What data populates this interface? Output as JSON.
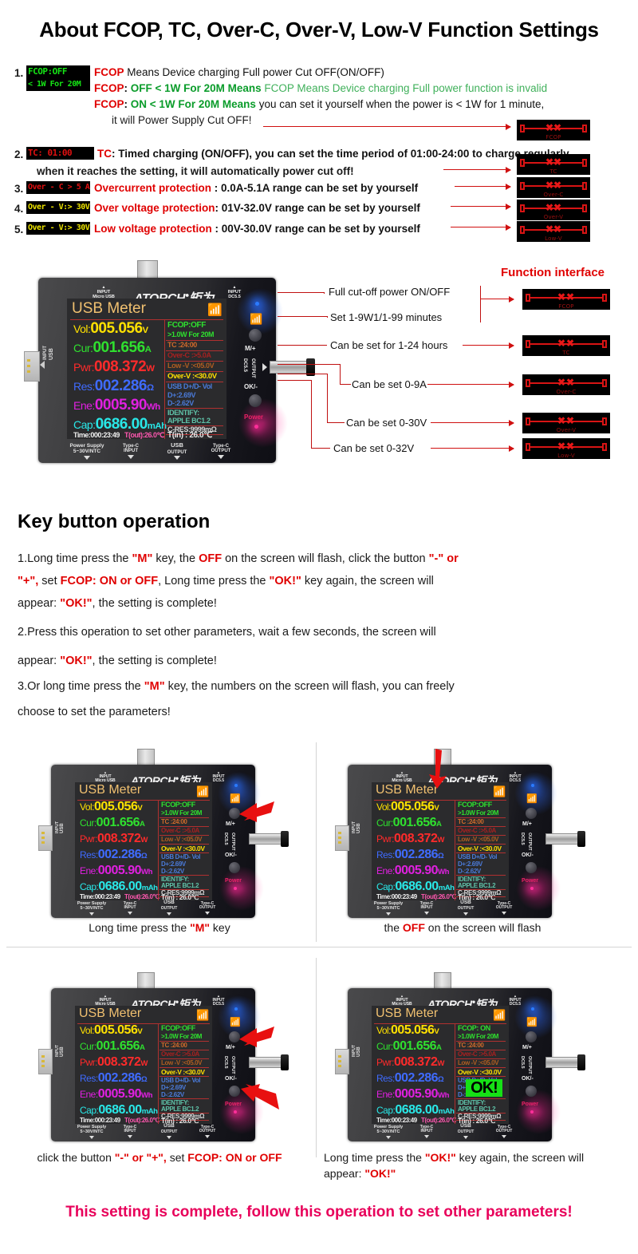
{
  "title": "About FCOP, TC, Over-C, Over-V, Low-V Function Settings",
  "list": {
    "items": [
      {
        "num": "1.",
        "badge_line1": "FCOP:OFF",
        "badge_line2": "< 1W For 20M",
        "line1_a": "FCOP",
        "line1_b": " Means Device charging Full power Cut OFF(ON/OFF)",
        "line2_a": "FCOP",
        "line2_b": ": ",
        "line2_c": "OFF < 1W For 20M Means",
        "line2_d": " FCOP Means Device charging Full power function is invalid",
        "line3_a": "FCOP",
        "line3_b": ": ",
        "line3_c": "ON  < 1W For 20M Means",
        "line3_d": " you can set it yourself when the power is < 1W for 1 minute,",
        "line4": "it will Power Supply Cut OFF!"
      },
      {
        "num": "2.",
        "badge": "TC:        01:00",
        "line1_a": "TC",
        "line1_b": ": Timed charging (ON/OFF), you can set the time period of 01:00-24:00 to charge regularly",
        "line2": "when it reaches the setting, it will automatically power cut off!"
      },
      {
        "num": "3.",
        "badge": "Over - C > 5 A",
        "line_a": "Overcurrent protection",
        "line_b": " : 0.0A-5.1A range can be set by yourself"
      },
      {
        "num": "4.",
        "badge": "Over - V:> 30V",
        "line_a": "Over voltage protection",
        "line_b": ": 01V-32.0V range can be set by yourself"
      },
      {
        "num": "5.",
        "badge": "Over - V:> 30V",
        "line_a": "Low voltage protection",
        "line_b": " : 00V-30.0V range can be set by yourself"
      }
    ]
  },
  "function_interface": {
    "heading": "Function interface",
    "icons": [
      "FCOP",
      "TC",
      "Over-C",
      "Over-V",
      "Low-V"
    ]
  },
  "device": {
    "brand": "ATORCH",
    "brand_cn": "矩为",
    "input_micro_usb": "INPUT\nMicro USB",
    "input_micro_usb_l1": "INPUT",
    "input_micro_usb_l2": "Micro USB",
    "input_dc_l1": "INPUT",
    "input_dc_l2": "DC5.5",
    "screen_title": "USB Meter",
    "bluetooth_icon": "bluetooth-icon",
    "rows": [
      {
        "label": "Vol:",
        "value": "005.056",
        "unit": "V",
        "color": "#ffe100"
      },
      {
        "label": "Cur:",
        "value": "001.656",
        "unit": "A",
        "color": "#2fe02f"
      },
      {
        "label": "Pwr:",
        "value": "008.372",
        "unit": "W",
        "color": "#ff2b2b"
      },
      {
        "label": "Res:",
        "value": "002.286",
        "unit": "Ω",
        "color": "#3f6bff"
      },
      {
        "label": "Ene:",
        "value": "0005.90",
        "unit": "Wh",
        "color": "#e020e0"
      },
      {
        "label": "Cap:",
        "value": "0686.00",
        "unit": "mAh",
        "color": "#29e8e8"
      }
    ],
    "time_line": "Time:000:23:49",
    "tout_line": "T(out):26.0℃",
    "right_lines": [
      {
        "text": "FCOP:OFF",
        "color": "#2ee02e"
      },
      {
        "text": ">1.0W  For  20M",
        "color": "#2ee02e"
      },
      {
        "text": "TC  :24:00",
        "color": "#d06a2a"
      },
      {
        "text": "Over-C :>5.0A",
        "color": "#a82020"
      },
      {
        "text": "Low -V :<05.0V",
        "color": "#b05e20"
      },
      {
        "text": "Over-V :<30.0V",
        "color": "#ffe100"
      },
      {
        "text": "USB D+/D- Vol",
        "color": "#4a7ad8"
      },
      {
        "text": "D+:2.69V",
        "color": "#4a7ad8"
      },
      {
        "text": "D-:2.62V",
        "color": "#4a7ad8"
      },
      {
        "text": "IDENTIFY:",
        "color": "#5fc2a8"
      },
      {
        "text": "APPLE      BC1.2",
        "color": "#5fc2a8"
      },
      {
        "text": "C-RES:9999mΩ",
        "color": "#d8d8d8"
      },
      {
        "text": "T(in)  :  26.0℃",
        "color": "#e8e8e8"
      }
    ],
    "right_lines_on": [
      {
        "text": "FCOP: ON",
        "color": "#2ee02e"
      },
      {
        "text": ">1.0W  For  20M",
        "color": "#2ee02e"
      }
    ],
    "fcop_on_text": "FCOP: ON",
    "side_buttons": {
      "m_plus": "M/+",
      "ok_minus": "OK/-",
      "power": "Power",
      "dc_out_l1": "DC5.5",
      "dc_out_l2": "OUTPUT"
    },
    "left_label_l1": "INPUT",
    "left_label_l2": "USB",
    "ports": [
      {
        "l1": "Power Supply",
        "l2": "5~30V/NTC"
      },
      {
        "l1": "Type-C",
        "l2": "INPUT"
      },
      {
        "l1": "USB",
        "l2": "OUTPUT"
      },
      {
        "l1": "Type-C",
        "l2": "OUTPUT"
      }
    ],
    "ok_badge": "OK!"
  },
  "callouts": [
    "Full cut-off power ON/OFF",
    "Set 1-9W1/1-99 minutes",
    "Can be set for 1-24 hours",
    "Can be set 0-9A",
    "Can be set 0-30V",
    "Can be set 0-32V"
  ],
  "key_operation": {
    "heading": "Key button operation",
    "l1_a": "1.Long time press the ",
    "l1_b": "\"M\"",
    "l1_c": " key, the ",
    "l1_d": "OFF",
    "l1_e": " on the screen will flash, click the button ",
    "l1_f": "\"-\" or",
    "l2_a": "\"+\",",
    "l2_b": " set ",
    "l2_c": "FCOP: ON or OFF",
    "l2_d": ", Long time press the ",
    "l2_e": "\"OK!\"",
    "l2_f": " key again, the screen will",
    "l3_a": "appear: ",
    "l3_b": "\"OK!\"",
    "l3_c": ", the setting is complete!",
    "l4": "2.Press this operation to set other parameters, wait a few seconds, the screen will",
    "l5_a": "appear: ",
    "l5_b": "\"OK!\"",
    "l5_c": ", the setting is complete!",
    "l6_a": "3.Or long time press the ",
    "l6_b": "\"M\"",
    "l6_c": " key, the numbers on the screen will flash, you can freely",
    "l7": "choose to set the parameters!"
  },
  "panel_captions": {
    "p1_a": "Long time press the ",
    "p1_b": "\"M\"",
    "p1_c": " key",
    "p2_a": "the ",
    "p2_b": "OFF",
    "p2_c": " on the screen will flash",
    "p3_a": "click the button ",
    "p3_b": "\"-\" or \"+\",",
    "p3_c": " set ",
    "p3_d": "FCOP: ON or OFF",
    "p4_a": "Long time press the ",
    "p4_b": "\"OK!\"",
    "p4_c": " key again, the screen will",
    "p4_d": "appear: ",
    "p4_e": "\"OK!\""
  },
  "final_note": "This setting is complete, follow this operation to set other parameters!",
  "colors": {
    "accent_red": "#e00000",
    "accent_green": "#0a9c2a",
    "magenta": "#e8005a",
    "lcd_green": "#15e515",
    "lcd_yellow": "#ece300"
  }
}
